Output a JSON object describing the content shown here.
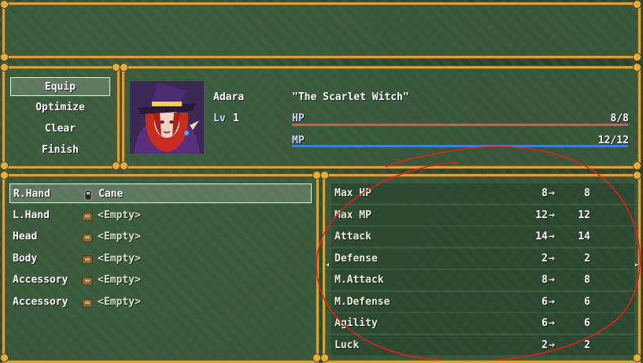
{
  "menu": {
    "commands": [
      {
        "label": "Equip",
        "selected": true
      },
      {
        "label": "Optimize",
        "selected": false
      },
      {
        "label": "Clear",
        "selected": false
      },
      {
        "label": "Finish",
        "selected": false
      }
    ]
  },
  "actor": {
    "name": "Adara",
    "level_label": "Lv",
    "level": "1",
    "nickname": "\"The Scarlet Witch\"",
    "hp_label": "HP",
    "hp_value": "8/8",
    "hp_fraction": 1.0,
    "mp_label": "MP",
    "mp_value": "12/12",
    "mp_fraction": 1.0,
    "hp_color": "#e0554e",
    "mp_color": "#3f7fd6"
  },
  "slots": [
    {
      "label": "R.Hand",
      "item": "Cane",
      "icon": "cane-icon",
      "selected": true
    },
    {
      "label": "L.Hand",
      "item": "<Empty>",
      "icon": "empty-slot-icon",
      "selected": false
    },
    {
      "label": "Head",
      "item": "<Empty>",
      "icon": "empty-slot-icon",
      "selected": false
    },
    {
      "label": "Body",
      "item": "<Empty>",
      "icon": "empty-slot-icon",
      "selected": false
    },
    {
      "label": "Accessory",
      "item": "<Empty>",
      "icon": "empty-slot-icon",
      "selected": false
    },
    {
      "label": "Accessory",
      "item": "<Empty>",
      "icon": "empty-slot-icon",
      "selected": false
    }
  ],
  "stats": [
    {
      "name": "Max HP",
      "old": "8",
      "arrow": "→",
      "new": "8"
    },
    {
      "name": "Max MP",
      "old": "12",
      "arrow": "→",
      "new": "12"
    },
    {
      "name": "Attack",
      "old": "14",
      "arrow": "→",
      "new": "14"
    },
    {
      "name": "Defense",
      "old": "2",
      "arrow": "→",
      "new": "2"
    },
    {
      "name": "M.Attack",
      "old": "8",
      "arrow": "→",
      "new": "8"
    },
    {
      "name": "M.Defense",
      "old": "6",
      "arrow": "→",
      "new": "6"
    },
    {
      "name": "Agility",
      "old": "6",
      "arrow": "→",
      "new": "6"
    },
    {
      "name": "Luck",
      "old": "2",
      "arrow": "→",
      "new": "2"
    }
  ],
  "colors": {
    "frame": "#d2a437",
    "annotation": "#e0201a"
  }
}
